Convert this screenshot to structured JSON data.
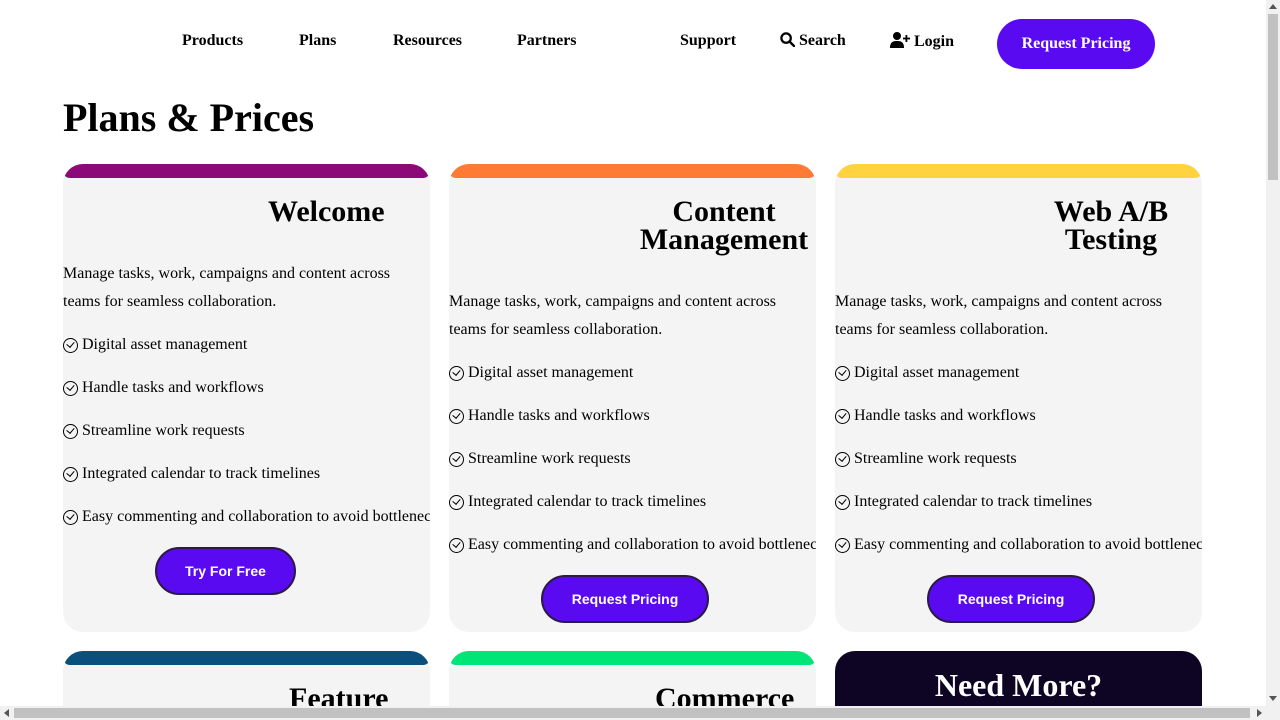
{
  "nav": {
    "products": "Products",
    "plans": "Plans",
    "resources": "Resources",
    "partners": "Partners",
    "support": "Support",
    "search": "Search",
    "login": "Login",
    "cta": "Request Pricing"
  },
  "page": {
    "title": "Plans & Prices"
  },
  "cards": [
    {
      "title": "Welcome",
      "accent": "#8b0a78",
      "description": "Manage tasks, work, campaigns and content across teams for seamless collaboration.",
      "features": [
        "Digital asset management",
        "Handle tasks and workflows",
        "Streamline work requests",
        "Integrated calendar to track timelines",
        "Easy commenting and collaboration to avoid bottlenecks"
      ],
      "button": "Try For Free"
    },
    {
      "title_line1": "Content",
      "title_line2": "Management",
      "accent": "#ff7a35",
      "description": "Manage tasks, work, campaigns and content across teams for seamless collaboration.",
      "features": [
        "Digital asset management",
        "Handle tasks and workflows",
        "Streamline work requests",
        "Integrated calendar to track timelines",
        "Easy commenting and collaboration to avoid bottlenecks"
      ],
      "button": "Request Pricing"
    },
    {
      "title_line1": "Web A/B",
      "title_line2": "Testing",
      "accent": "#ffd23f",
      "description": "Manage tasks, work, campaigns and content across teams for seamless collaboration.",
      "features": [
        "Digital asset management",
        "Handle tasks and workflows",
        "Streamline work requests",
        "Integrated calendar to track timelines",
        "Easy commenting and collaboration to avoid bottlenecks"
      ],
      "button": "Request Pricing"
    },
    {
      "title": "Feature",
      "accent": "#0b4f7c"
    },
    {
      "title": "Commerce",
      "accent": "#00e676"
    }
  ],
  "more": {
    "title": "Need More?"
  },
  "colors": {
    "primary": "#5a0af0",
    "card_bg": "#f4f4f4",
    "dark_card": "#0e0524"
  }
}
